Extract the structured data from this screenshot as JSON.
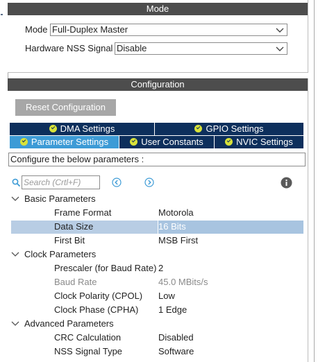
{
  "mode_panel": {
    "header": "Mode",
    "mode_label": "Mode",
    "mode_value": "Full-Duplex Master",
    "nss_label": "Hardware NSS Signal",
    "nss_value": "Disable"
  },
  "config_panel": {
    "header": "Configuration",
    "reset_button": "Reset Configuration",
    "tabs_row1": [
      {
        "label": "DMA Settings"
      },
      {
        "label": "GPIO Settings"
      }
    ],
    "tabs_row2": [
      {
        "label": "Parameter Settings",
        "active": true
      },
      {
        "label": "User Constants"
      },
      {
        "label": "NVIC Settings"
      }
    ],
    "description": "Configure the below parameters :",
    "search_placeholder": "Search (Crtl+F)",
    "groups": [
      {
        "label": "Basic Parameters",
        "params": [
          {
            "name": "Frame Format",
            "value": "Motorola"
          },
          {
            "name": "Data Size",
            "value": "16 Bits",
            "selected": true
          },
          {
            "name": "First Bit",
            "value": "MSB First"
          }
        ]
      },
      {
        "label": "Clock Parameters",
        "params": [
          {
            "name": "Prescaler (for Baud Rate)",
            "value": "2"
          },
          {
            "name": "Baud Rate",
            "value": "45.0 MBits/s",
            "disabled": true
          },
          {
            "name": "Clock Polarity (CPOL)",
            "value": "Low"
          },
          {
            "name": "Clock Phase (CPHA)",
            "value": "1 Edge"
          }
        ]
      },
      {
        "label": "Advanced Parameters",
        "params": [
          {
            "name": "CRC Calculation",
            "value": "Disabled"
          },
          {
            "name": "NSS Signal Type",
            "value": "Software"
          }
        ]
      }
    ]
  },
  "colors": {
    "header_bg": "#4d4d4d",
    "tab_bg": "#0d2f5c",
    "tab_active_bg": "#3d9bd6",
    "check_icon": "#d8e23a",
    "selection_bg": "#b8cde4",
    "nav_icon": "#3d9bd6"
  },
  "icons": {
    "search": "search-icon",
    "prev": "arrow-left-circle-icon",
    "next": "arrow-right-circle-icon",
    "info": "info-icon",
    "expand": "chevron-down-icon",
    "tab_check": "check-circle-icon",
    "dropdown": "chevron-down-icon"
  }
}
